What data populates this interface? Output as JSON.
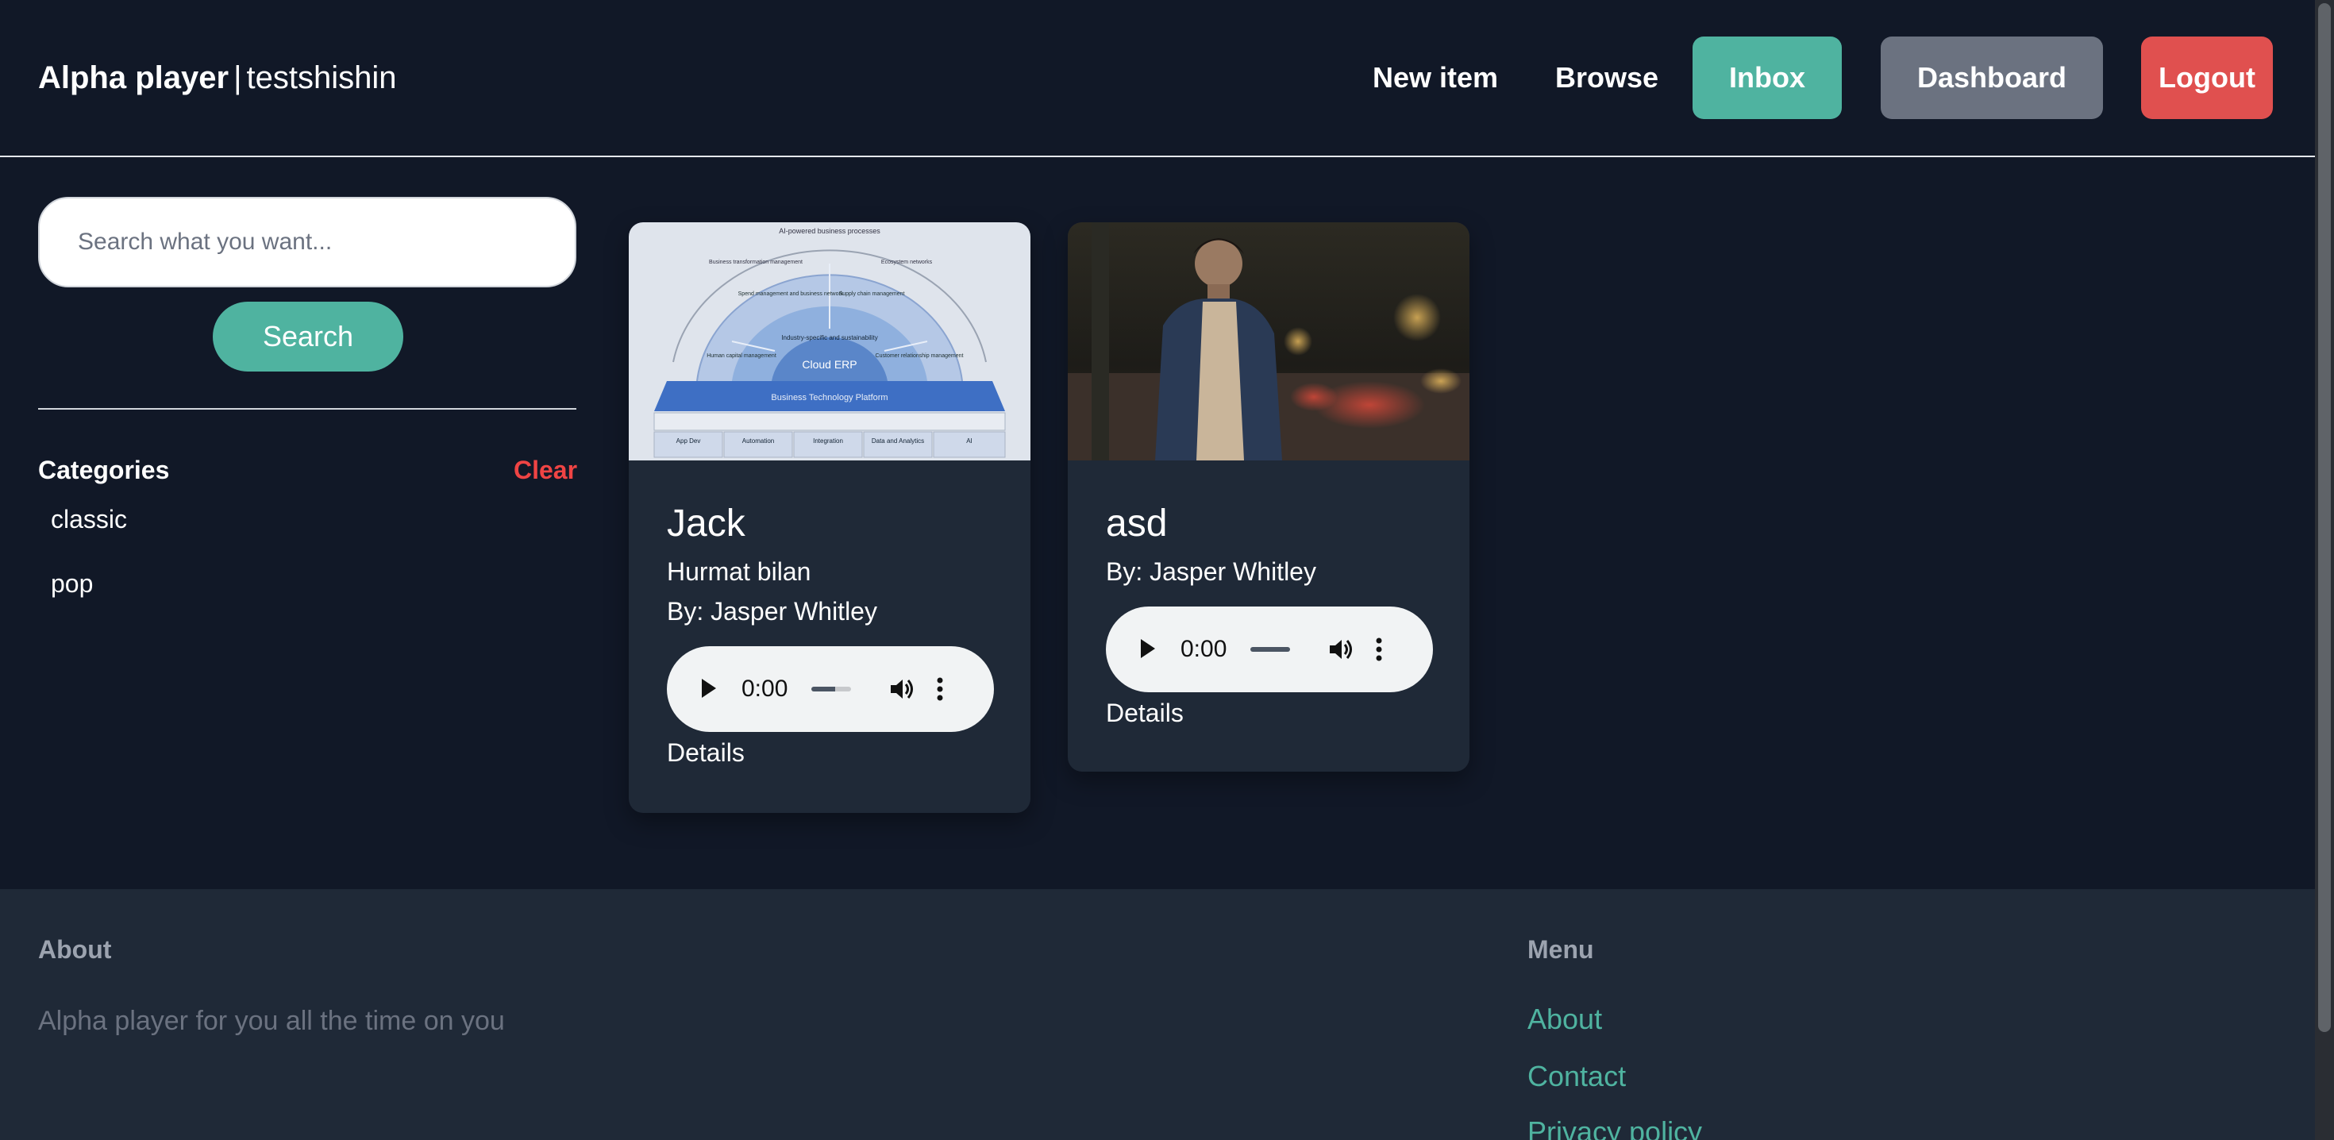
{
  "header": {
    "brand_name": "Alpha player",
    "separator": "|",
    "username": "testshishin",
    "nav": {
      "new_item": "New item",
      "browse": "Browse",
      "inbox": "Inbox",
      "dashboard": "Dashboard",
      "logout": "Logout"
    }
  },
  "sidebar": {
    "search": {
      "placeholder": "Search what you want...",
      "value": "",
      "button": "Search"
    },
    "categories": {
      "heading": "Categories",
      "clear": "Clear",
      "items": [
        {
          "label": "classic"
        },
        {
          "label": "pop"
        }
      ]
    }
  },
  "items": [
    {
      "title": "Jack",
      "subtitle": "Hurmat bilan",
      "author": "By: Jasper Whitley",
      "image": "cloud-erp-diagram-thumbnail",
      "audio": {
        "time": "0:00",
        "progress": 0.0
      },
      "details": "Details"
    },
    {
      "title": "asd",
      "author": "By: Jasper Whitley",
      "image": "man-in-city-street-at-night-thumbnail",
      "audio": {
        "time": "0:00",
        "progress": 0.0
      },
      "details": "Details"
    }
  ],
  "thumbnail_text": {
    "arc_outer": "AI-powered business processes",
    "arc_left": "Business transformation management",
    "arc_right": "Ecosystem networks",
    "seg_spend": "Spend management and business network",
    "seg_supply": "Supply chain management",
    "seg_human": "Human capital management",
    "seg_customer": "Customer relationship management",
    "industry": "Industry-specific and sustainability",
    "core": "Cloud ERP",
    "platform": "Business Technology Platform",
    "pillar_1": "App Dev",
    "pillar_2": "Automation",
    "pillar_3": "Integration",
    "pillar_4": "Data and Analytics",
    "pillar_5": "AI"
  },
  "footer": {
    "about_heading": "About",
    "about_text": "Alpha player for you all the time on you",
    "menu_heading": "Menu",
    "menu_links": [
      {
        "label": "About"
      },
      {
        "label": "Contact"
      },
      {
        "label": "Privacy policy"
      }
    ]
  },
  "colors": {
    "page_bg": "#111827",
    "card_bg": "#1f2937",
    "accent": "#4fb3a0",
    "dashboard_btn": "#6b7280",
    "logout_btn": "#e0504f",
    "clear_text": "#ef4444"
  },
  "icons": [
    "play-icon",
    "volume-icon",
    "more-options-icon"
  ]
}
